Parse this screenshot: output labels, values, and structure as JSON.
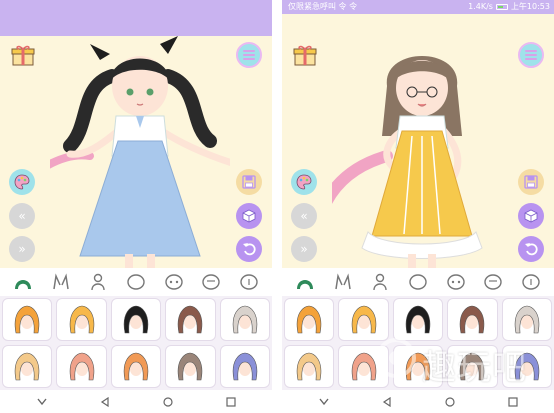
{
  "screens": [
    {
      "status_bar": {
        "carrier": "",
        "speed": "",
        "time": ""
      },
      "outfit": {
        "dress_color": "#a9c8ec",
        "hair_color": "#2a2a2a"
      }
    },
    {
      "status_bar": {
        "carrier": "仅限紧急呼叫 令 令",
        "speed": "1.4K/s",
        "time": "上午10:53"
      },
      "outfit": {
        "dress_color": "#f6c94c",
        "hair_color": "#8a7563"
      }
    }
  ],
  "toolbar": {
    "gift_icon": "gift-icon",
    "menu_icon": "hamburger-menu-icon",
    "palette_icon": "palette-icon",
    "prev_label": "«",
    "next_label": "»",
    "save_icon": "floppy-disk-icon",
    "random_icon": "dice-icon",
    "undo_icon": "undo-icon"
  },
  "categories": [
    "hair",
    "ears",
    "body",
    "face",
    "eyes",
    "mouth",
    "accessory"
  ],
  "hair_swatches": [
    [
      "#f4a23a",
      "#f7b84a",
      "#1e1e1e",
      "#8a5a4b",
      "#d9d2cc"
    ],
    [
      "#f3c98a",
      "#f0a28a",
      "#f19a56",
      "#9a8579",
      "#8a90d8"
    ]
  ],
  "nav_buttons": [
    "back-icon",
    "home-icon",
    "recents-icon"
  ],
  "watermark": {
    "text": "趣玩吧"
  },
  "colors": {
    "status_bar": "#c9b3f0",
    "background": "#fdf6dc",
    "accent_teal": "#9fe2ea",
    "accent_purple": "#b893f0",
    "accent_gold": "#f5dca3"
  }
}
